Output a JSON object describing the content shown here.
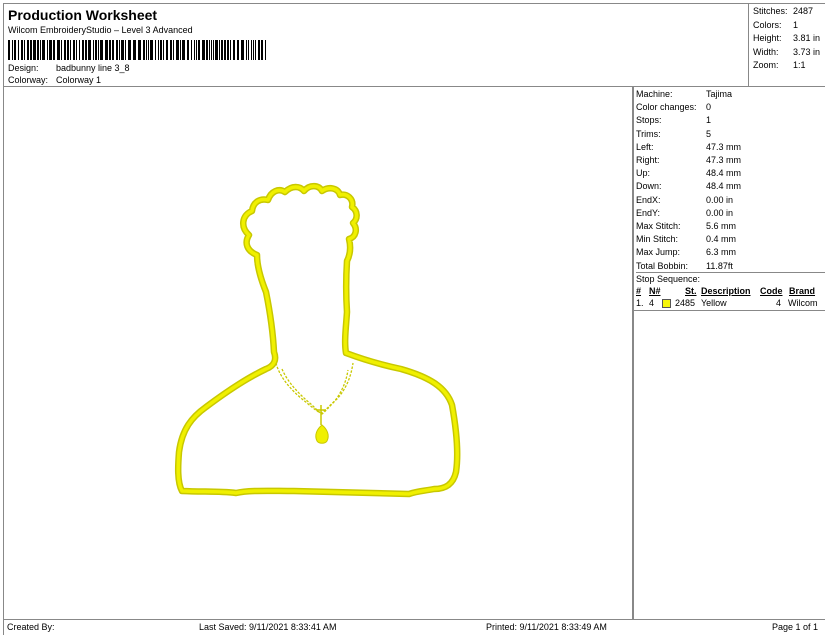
{
  "header": {
    "title": "Production Worksheet",
    "subtitle": "Wilcom EmbroideryStudio – Level 3 Advanced",
    "design_label": "Design:",
    "design_value": "badbunny line 3_8",
    "colorway_label": "Colorway:",
    "colorway_value": "Colorway 1"
  },
  "stats": {
    "stitches_label": "Stitches:",
    "stitches_value": "2487",
    "colors_label": "Colors:",
    "colors_value": "1",
    "height_label": "Height:",
    "height_value": "3.81 in",
    "width_label": "Width:",
    "width_value": "3.73 in",
    "zoom_label": "Zoom:",
    "zoom_value": "1:1"
  },
  "machine_info": [
    {
      "label": "Machine:",
      "value": "Tajima"
    },
    {
      "label": "Color changes:",
      "value": "0"
    },
    {
      "label": "Stops:",
      "value": "1"
    },
    {
      "label": "Trims:",
      "value": "5"
    },
    {
      "label": "Left:",
      "value": "47.3 mm"
    },
    {
      "label": "Right:",
      "value": "47.3 mm"
    },
    {
      "label": "Up:",
      "value": "48.4 mm"
    },
    {
      "label": "Down:",
      "value": "48.4 mm"
    },
    {
      "label": "EndX:",
      "value": "0.00 in"
    },
    {
      "label": "EndY:",
      "value": "0.00 in"
    },
    {
      "label": "Max Stitch:",
      "value": "5.6 mm"
    },
    {
      "label": "Min Stitch:",
      "value": "0.4 mm"
    },
    {
      "label": "Max Jump:",
      "value": "6.3 mm"
    },
    {
      "label": "Total Bobbin:",
      "value": "11.87ft"
    }
  ],
  "stop_sequence": {
    "title": "Stop Sequence:",
    "columns": {
      "num": "#",
      "needle": "N#",
      "stitches": "St.",
      "description": "Description",
      "code": "Code",
      "brand": "Brand"
    },
    "rows": [
      {
        "num": "1.",
        "needle": "4",
        "stitches": "2485",
        "description": "Yellow",
        "code": "4",
        "brand": "Wilcom",
        "color": "#f5f50a"
      }
    ]
  },
  "design": {
    "thread_color": "#f0f000",
    "thread_shadow": "#c8c800"
  },
  "footer": {
    "created_by": "Created By:",
    "last_saved": "Last Saved: 9/11/2021 8:33:41 AM",
    "printed": "Printed: 9/11/2021 8:33:49 AM",
    "page": "Page 1 of 1"
  }
}
